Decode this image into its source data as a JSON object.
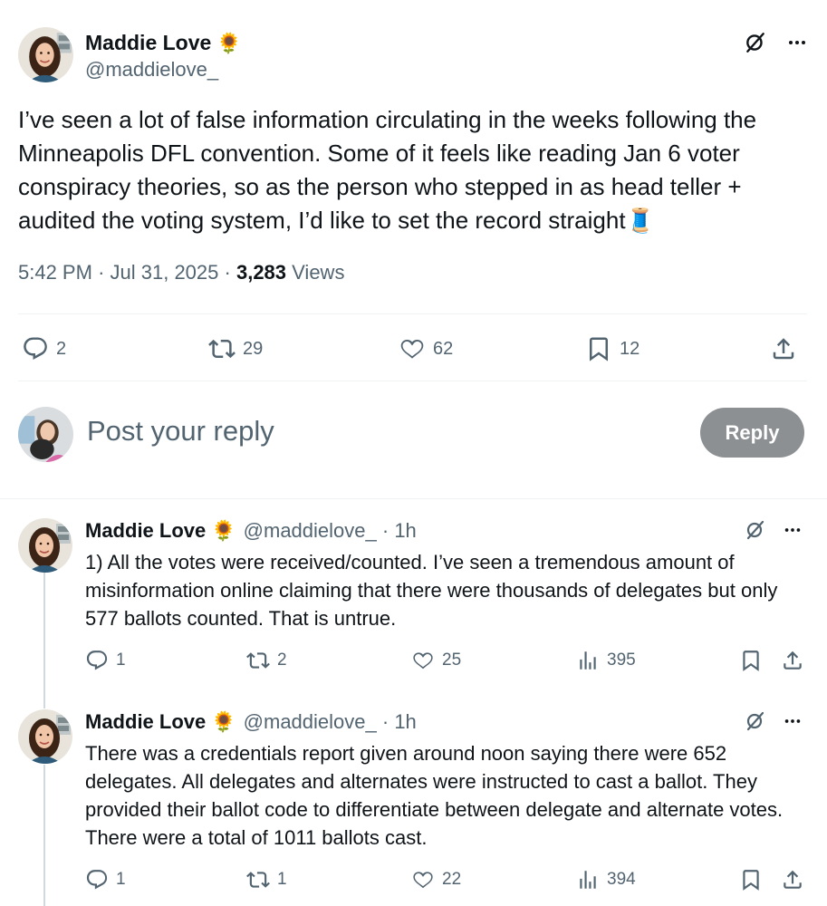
{
  "main_tweet": {
    "author_name": "Maddie Love",
    "author_emoji": "🌻",
    "author_handle": "@maddielove_",
    "text": "I’ve seen a lot of false information circulating in the weeks following the Minneapolis DFL convention. Some of it feels like reading Jan 6 voter conspiracy theories, so as the person who stepped in as head teller + audited the voting system, I’d like to set the record straight🧵",
    "time": "5:42 PM",
    "date": "Jul 31, 2025",
    "views_count": "3,283",
    "views_label": "Views",
    "replies": "2",
    "reposts": "29",
    "likes": "62",
    "bookmarks": "12"
  },
  "reply_composer": {
    "placeholder": "Post your reply",
    "button_label": "Reply"
  },
  "thread": [
    {
      "author_name": "Maddie Love",
      "author_emoji": "🌻",
      "author_handle": "@maddielove_",
      "age": "1h",
      "text": "1) All the votes were received/counted. I’ve seen a tremendous amount of misinformation online claiming that there were thousands of delegates but only 577 ballots counted. That is untrue.",
      "replies": "1",
      "reposts": "2",
      "likes": "25",
      "views": "395"
    },
    {
      "author_name": "Maddie Love",
      "author_emoji": "🌻",
      "author_handle": "@maddielove_",
      "age": "1h",
      "text": "There was a credentials report given around noon saying there were 652 delegates. All delegates and alternates were instructed to cast a ballot. They provided their ballot code to differentiate between delegate and alternate votes. There were a total of 1011 ballots cast.",
      "replies": "1",
      "reposts": "1",
      "likes": "22",
      "views": "394"
    }
  ],
  "colors": {
    "text_primary": "#0f1419",
    "text_secondary": "#536471",
    "divider": "#eff3f4",
    "reply_button_disabled": "#8c9093"
  },
  "icons": [
    "grok-icon",
    "more-icon",
    "reply-icon",
    "repost-icon",
    "like-icon",
    "bookmark-icon",
    "share-icon",
    "views-icon"
  ]
}
